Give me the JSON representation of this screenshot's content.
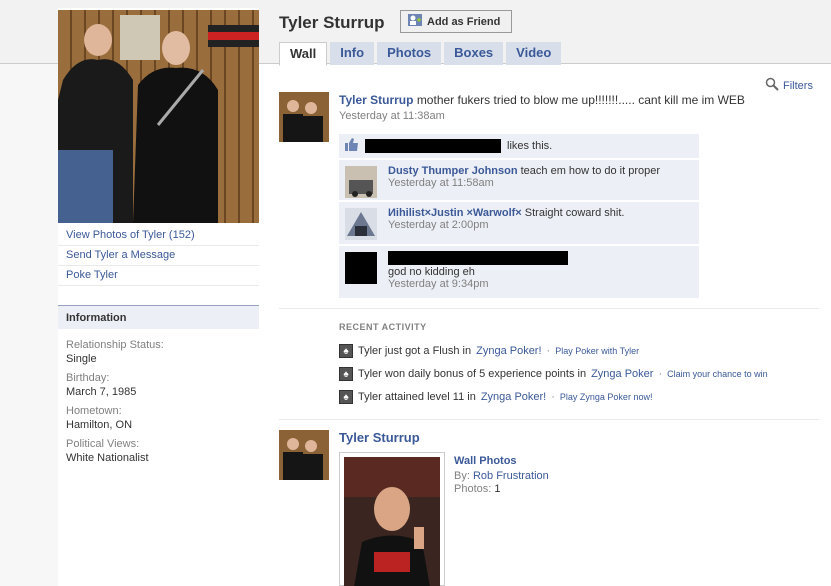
{
  "profile": {
    "name": "Tyler Sturrup",
    "add_friend": "Add as Friend",
    "links": [
      "View Photos of Tyler (152)",
      "Send Tyler a Message",
      "Poke Tyler"
    ]
  },
  "tabs": [
    "Wall",
    "Info",
    "Photos",
    "Boxes",
    "Video"
  ],
  "filters": "Filters",
  "info": {
    "heading": "Information",
    "fields": [
      {
        "label": "Relationship Status:",
        "value": "Single"
      },
      {
        "label": "Birthday:",
        "value": "March 7, 1985"
      },
      {
        "label": "Hometown:",
        "value": "Hamilton, ON"
      },
      {
        "label": "Political Views:",
        "value": "White Nationalist"
      }
    ]
  },
  "post": {
    "author": "Tyler Sturrup",
    "text": "mother fukers tried to blow me up!!!!!!!..... cant kill me im WEB",
    "time": "Yesterday at 11:38am",
    "likes_suffix": "likes this.",
    "comments": [
      {
        "name": "Dusty Thumper Johnson",
        "text": "teach em how to do it proper",
        "time": "Yesterday at 11:58am"
      },
      {
        "name": "Иihilist×Justin ×Warwolf×",
        "text": "Straight coward shit.",
        "time": "Yesterday at 2:00pm"
      },
      {
        "name": "",
        "text": "god no kidding eh",
        "time": "Yesterday at 9:34pm"
      }
    ]
  },
  "recent": {
    "title": "RECENT ACTIVITY",
    "items": [
      {
        "text": "Tyler just got a Flush in",
        "app": "Zynga Poker!",
        "sub": "Play Poker with Tyler"
      },
      {
        "text": "Tyler won daily bonus of 5 experience points in",
        "app": "Zynga Poker",
        "sub": "Claim your chance to win"
      },
      {
        "text": "Tyler attained level 11 in",
        "app": "Zynga Poker!",
        "sub": "Play Zynga Poker now!"
      }
    ]
  },
  "wall_photos": {
    "author": "Tyler Sturrup",
    "title": "Wall Photos",
    "by_label": "By:",
    "by": "Rob Frustration",
    "photos_label": "Photos:",
    "photos_count": "1"
  },
  "colors": {
    "link": "#3b5998",
    "tab_bg": "#d8dfea",
    "comment_bg": "#eceff5"
  }
}
